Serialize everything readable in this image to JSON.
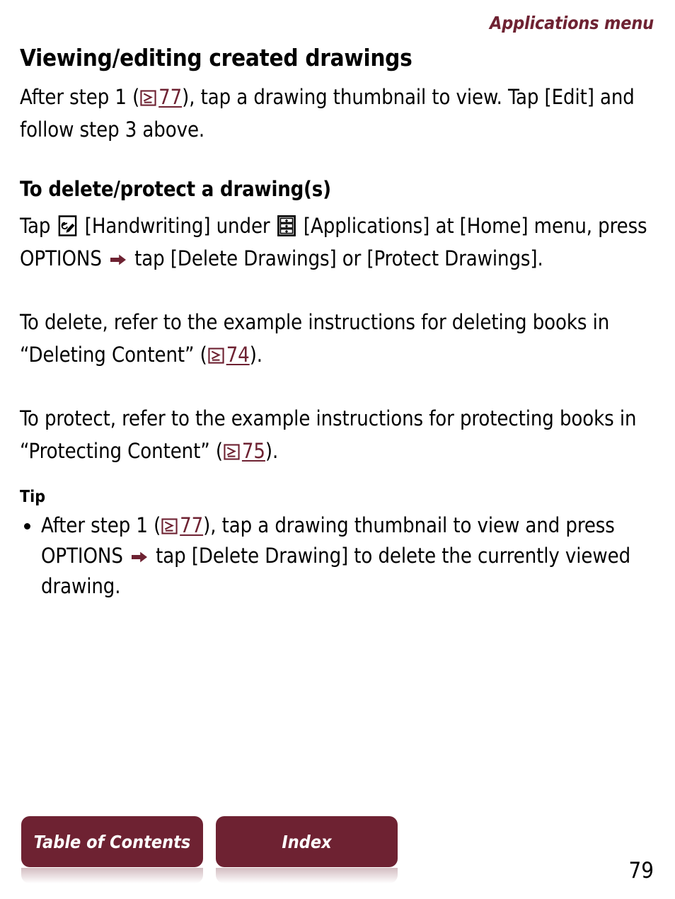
{
  "header": {
    "running_head": "Applications menu"
  },
  "colors": {
    "accent": "#6E2232",
    "text": "#000000",
    "background": "#FFFFFF",
    "button_text": "#FFFFFF"
  },
  "content": {
    "section_title": "Viewing/editing created drawings",
    "para1": {
      "before_ref": "After step 1 (",
      "ref_page": "77",
      "after_ref": "), tap a drawing thumbnail to view. Tap [Edit] and follow step 3 above."
    },
    "sub_title": "To delete/protect a drawing(s)",
    "para2": {
      "seg1": "Tap",
      "seg2": "[Handwriting] under",
      "seg3": "[Applications] at [Home] menu, press OPTIONS",
      "seg4": "tap [Delete Drawings] or [Protect Drawings]."
    },
    "para3": {
      "before_ref": "To delete, refer to the example instructions for deleting books in “Deleting Content” (",
      "ref_page": "74",
      "after_ref": ")."
    },
    "para4": {
      "before_ref": "To protect, refer to the example instructions for protecting books in “Protecting Content” (",
      "ref_page": "75",
      "after_ref": ")."
    },
    "tip_title": "Tip",
    "tip_item": {
      "before_ref": "After step 1 (",
      "ref_page": "77",
      "mid_ref": "), tap a drawing thumbnail to view and press OPTIONS",
      "after_arrow": "tap [Delete Drawing] to delete the currently viewed drawing."
    }
  },
  "footer": {
    "toc_label": "Table of Contents",
    "index_label": "Index",
    "page_number": "79"
  },
  "icons": {
    "page_ref": "page-reference-icon",
    "arrow": "right-arrow-icon",
    "handwriting": "handwriting-app-icon",
    "applications": "applications-menu-icon"
  }
}
